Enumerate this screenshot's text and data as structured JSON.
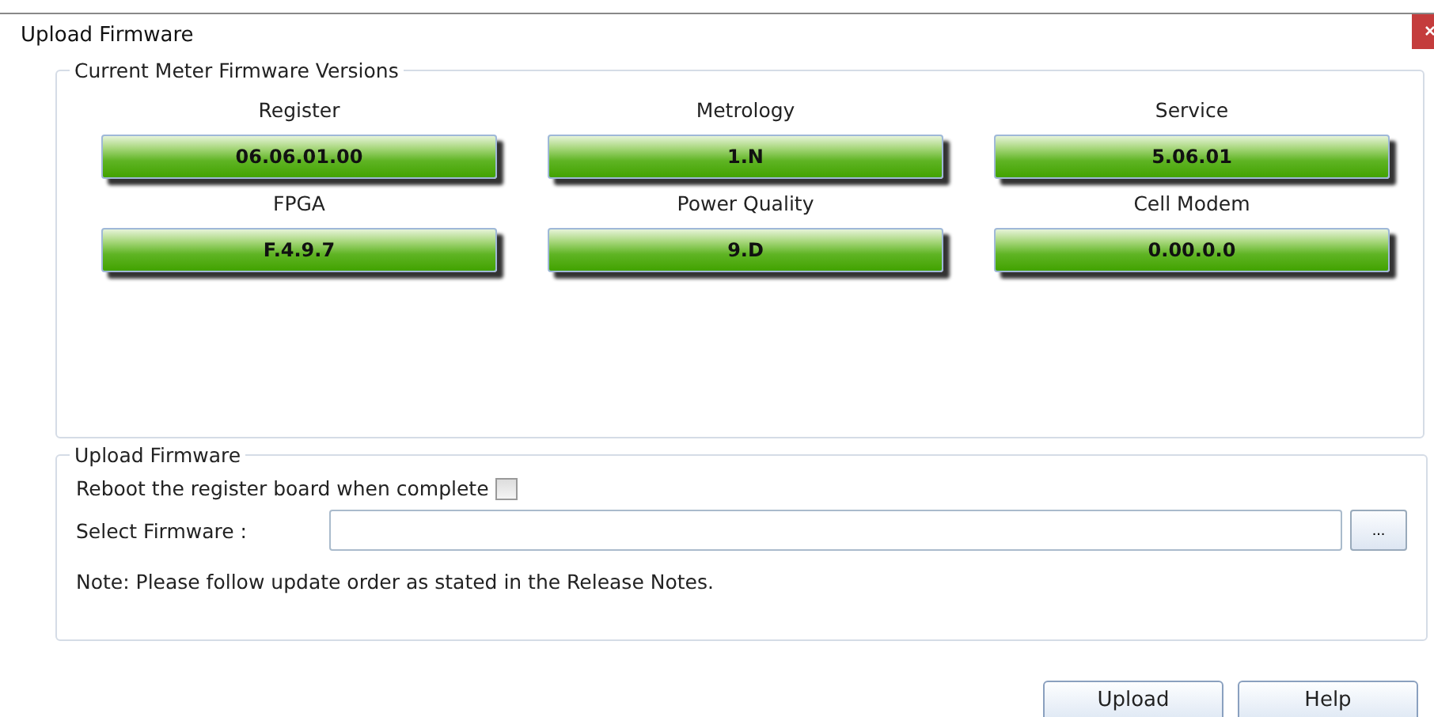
{
  "window": {
    "title": "Upload Firmware"
  },
  "versions": {
    "title": "Current Meter Firmware Versions",
    "items": [
      {
        "label": "Register",
        "value": "06.06.01.00"
      },
      {
        "label": "Metrology",
        "value": "1.N"
      },
      {
        "label": "Service",
        "value": "5.06.01"
      },
      {
        "label": "FPGA",
        "value": "F.4.9.7"
      },
      {
        "label": "Power Quality",
        "value": "9.D"
      },
      {
        "label": "Cell Modem",
        "value": "0.00.0.0"
      }
    ]
  },
  "upload": {
    "title": "Upload Firmware",
    "reboot": {
      "label": "Reboot the register board when complete",
      "checked": false
    },
    "select_label": "Select Firmware :",
    "browse": "...",
    "note": "Note: Please follow update order as stated in the Release Notes."
  },
  "buttons": [
    "Upload",
    "Help"
  ]
}
